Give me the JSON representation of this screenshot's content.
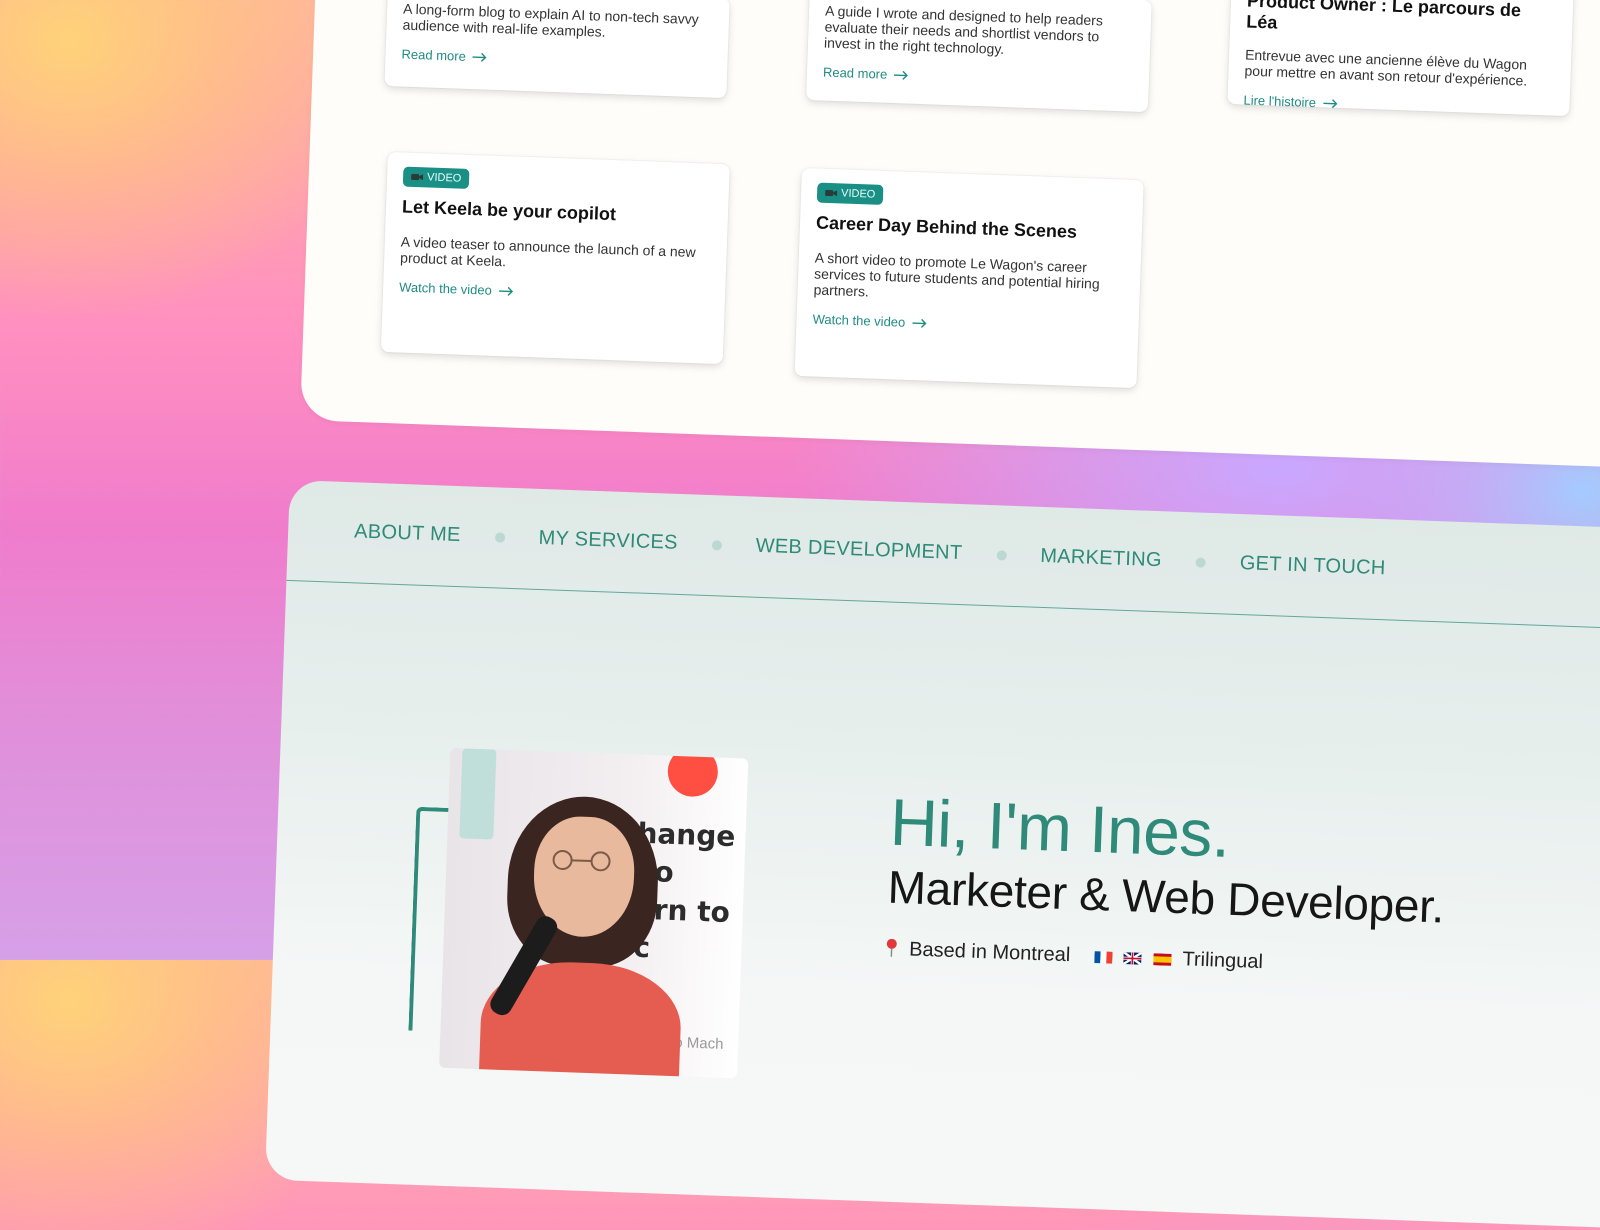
{
  "cards": [
    {
      "desc": "A long-form blog to explain AI to non-tech savvy audience with real-life examples.",
      "link": "Read more"
    },
    {
      "desc": "A guide I wrote and designed to help readers evaluate their needs and shortlist vendors to invest in the right technology.",
      "link": "Read more"
    },
    {
      "title": "Product Owner : Le parcours de Léa",
      "desc": "Entrevue avec une ancienne élève du Wagon pour mettre en avant son retour d'expérience.",
      "link": "Lire l'histoire"
    },
    {
      "badge": "VIDEO",
      "title": "Let Keela be your copilot",
      "desc": "A video teaser to announce the launch of a new product at Keela.",
      "link": "Watch the video"
    },
    {
      "badge": "VIDEO",
      "title": "Career Day Behind the Scenes",
      "desc": "A short video to promote Le Wagon's career services to future students and potential hiring partners.",
      "link": "Watch the video"
    }
  ],
  "nav": {
    "about": "ABOUT ME",
    "services": "MY SERVICES",
    "webdev": "WEB DEVELOPMENT",
    "marketing": "MARKETING",
    "contact": "GET IN TOUCH"
  },
  "hero": {
    "greeting": "Hi, I'm Ines.",
    "role": "Marketer & Web Developer.",
    "location": "Based in Montreal",
    "languages": "Trilingual",
    "photo_banner_line1": "hange yo",
    "photo_banner_line2": "arn to c",
    "photo_footer": "to Mach"
  },
  "colors": {
    "accent": "#2f8a79",
    "badge": "#1a8f85"
  },
  "icons": {
    "arrow": "arrow-right-icon",
    "camera": "video-camera-icon",
    "pin": "location-pin-icon"
  }
}
